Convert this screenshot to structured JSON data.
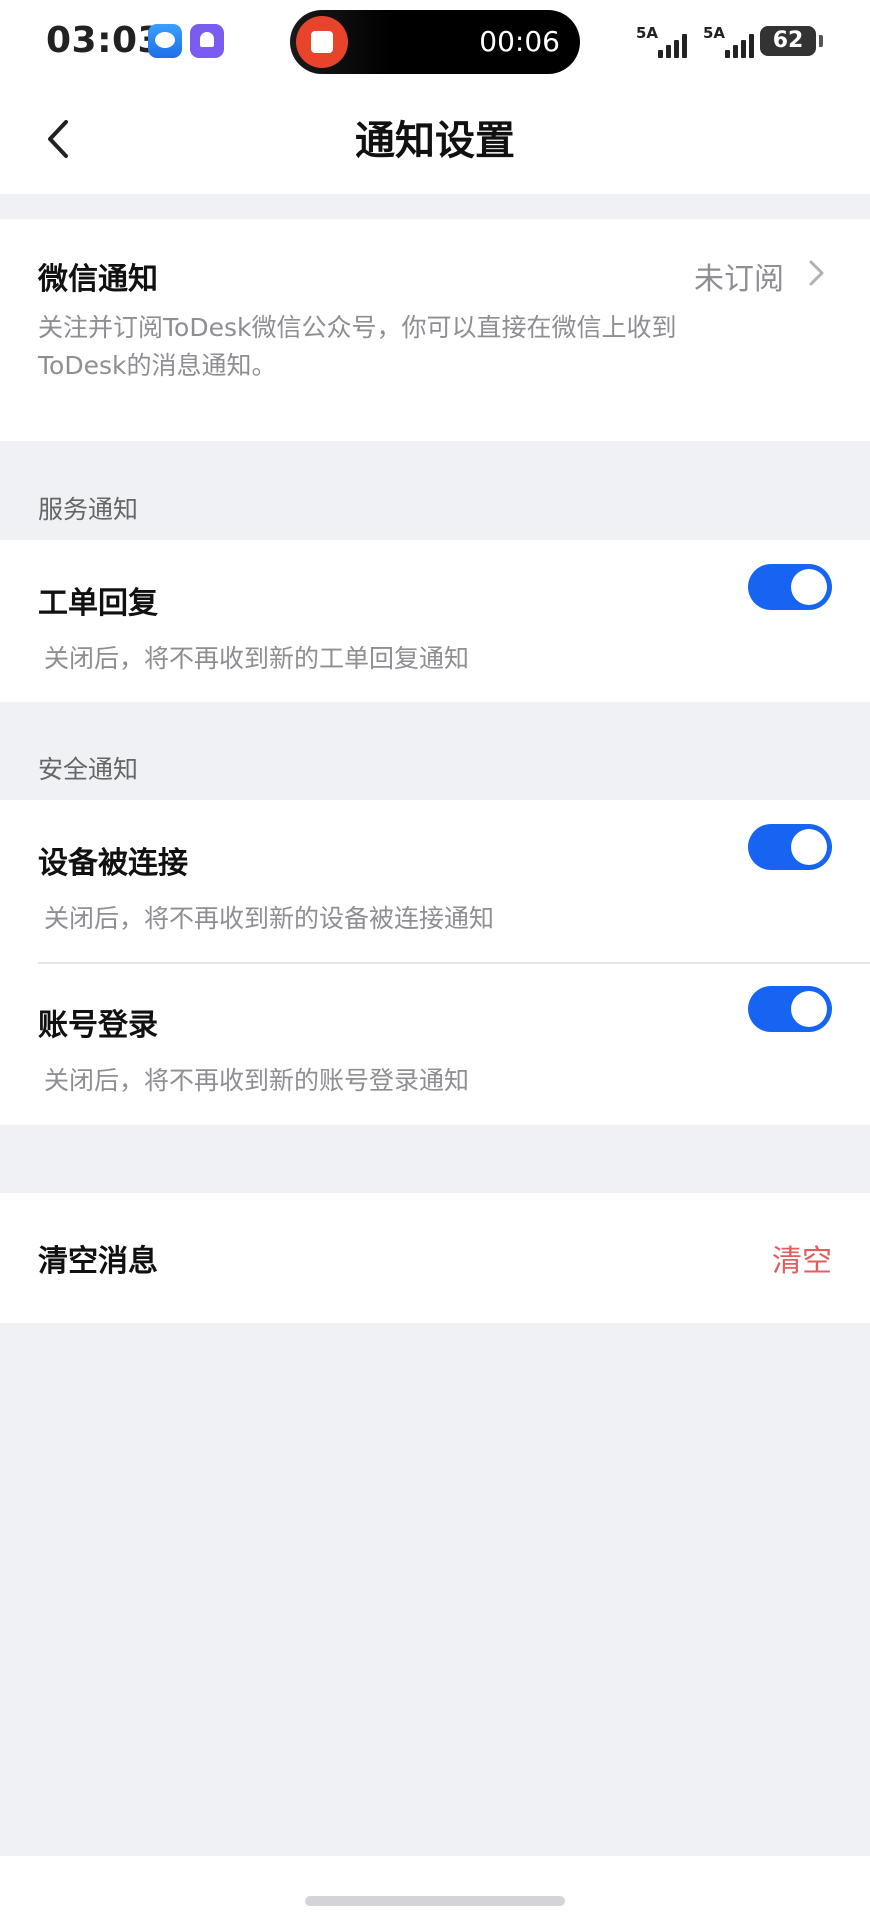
{
  "status_bar": {
    "time": "03:03",
    "recording_time": "00:06",
    "network1": "5A",
    "network2": "5A",
    "battery": "62"
  },
  "nav": {
    "title": "通知设置"
  },
  "wechat": {
    "title": "微信通知",
    "status": "未订阅",
    "description_line1": "关注并订阅ToDesk微信公众号，你可以直接在微信上收到",
    "description_line2": "ToDesk的消息通知。"
  },
  "service_section": {
    "label": "服务通知",
    "items": [
      {
        "title": "工单回复",
        "description": "关闭后，将不再收到新的工单回复通知",
        "enabled": true
      }
    ]
  },
  "security_section": {
    "label": "安全通知",
    "items": [
      {
        "title": "设备被连接",
        "description": "关闭后，将不再收到新的设备被连接通知",
        "enabled": true
      },
      {
        "title": "账号登录",
        "description": "关闭后，将不再收到新的账号登录通知",
        "enabled": true
      }
    ]
  },
  "clear": {
    "title": "清空消息",
    "action": "清空"
  },
  "colors": {
    "accent": "#1763f2",
    "danger": "#e25d5d",
    "background": "#f0f1f5"
  }
}
